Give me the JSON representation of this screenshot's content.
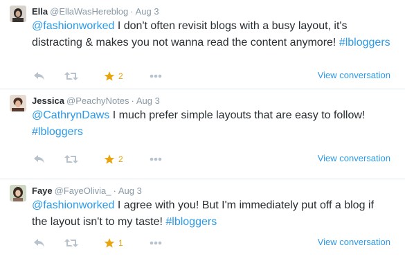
{
  "tweets": [
    {
      "name": "Ella",
      "handle": "@EllaWasHereblog",
      "time": "Aug 3",
      "mention": "@fashionworked",
      "text": " I don't often revisit blogs with a busy layout, it's distracting & makes you not wanna read the content anymore! ",
      "hashtag": "#lbloggers",
      "fav_count": "2",
      "view_label": "View conversation"
    },
    {
      "name": "Jessica",
      "handle": "@PeachyNotes",
      "time": "Aug 3",
      "mention": "@CathrynDaws",
      "text": " I much prefer simple layouts that are easy to follow! ",
      "hashtag": "#lbloggers",
      "fav_count": "2",
      "view_label": "View conversation"
    },
    {
      "name": "Faye",
      "handle": "@FayeOlivia_",
      "time": "Aug 3",
      "mention": "@fashionworked",
      "text": " I agree with you! But I'm immediately put off a blog if the layout isn't to my taste! ",
      "hashtag": "#lbloggers",
      "fav_count": "1",
      "view_label": "View conversation"
    }
  ],
  "separator": "·",
  "icons": {
    "reply": "reply-icon",
    "retweet": "retweet-icon",
    "favorite": "star-icon",
    "more": "more-icon"
  },
  "colors": {
    "link": "#2b9ae8",
    "muted": "#8899a6",
    "star": "#e8a40c",
    "text": "#292f33"
  }
}
